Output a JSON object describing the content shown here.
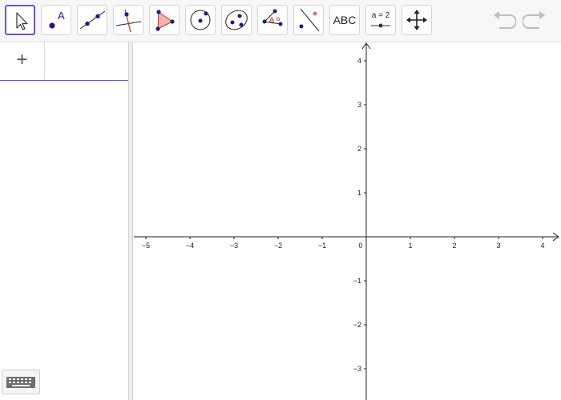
{
  "toolbar": {
    "tools": [
      {
        "name": "move-tool",
        "icon": "pointer-arrow-icon",
        "selected": true
      },
      {
        "name": "point-tool",
        "icon": "point-icon",
        "label": "A"
      },
      {
        "name": "line-tool",
        "icon": "line-through-points-icon"
      },
      {
        "name": "perpendicular-line-tool",
        "icon": "perpendicular-line-icon"
      },
      {
        "name": "polygon-tool",
        "icon": "polygon-icon"
      },
      {
        "name": "circle-tool",
        "icon": "circle-center-point-icon"
      },
      {
        "name": "conic-tool",
        "icon": "ellipse-icon"
      },
      {
        "name": "angle-tool",
        "icon": "angle-icon"
      },
      {
        "name": "reflect-tool",
        "icon": "reflect-about-line-icon"
      },
      {
        "name": "text-tool",
        "icon": "text-icon",
        "label": "ABC"
      },
      {
        "name": "slider-tool",
        "icon": "slider-icon",
        "label": "a = 2"
      },
      {
        "name": "move-graphics-view-tool",
        "icon": "move-view-icon"
      }
    ],
    "undo_icon": "undo-icon",
    "redo_icon": "redo-icon"
  },
  "algebra_view": {
    "add_button": "+",
    "keyboard_icon": "keyboard-icon"
  },
  "graphics_view": {
    "x_ticks": [
      "−5",
      "−4",
      "−3",
      "−2",
      "−1",
      "0",
      "1",
      "2",
      "3",
      "4"
    ],
    "y_ticks": [
      "4",
      "3",
      "2",
      "1",
      "−1",
      "−2",
      "−3"
    ]
  },
  "colors": {
    "selection": "#6557d2",
    "point": "#1a1a8c",
    "polygon_fill": "#f4b3a8",
    "polygon_edge": "#b33a22"
  }
}
